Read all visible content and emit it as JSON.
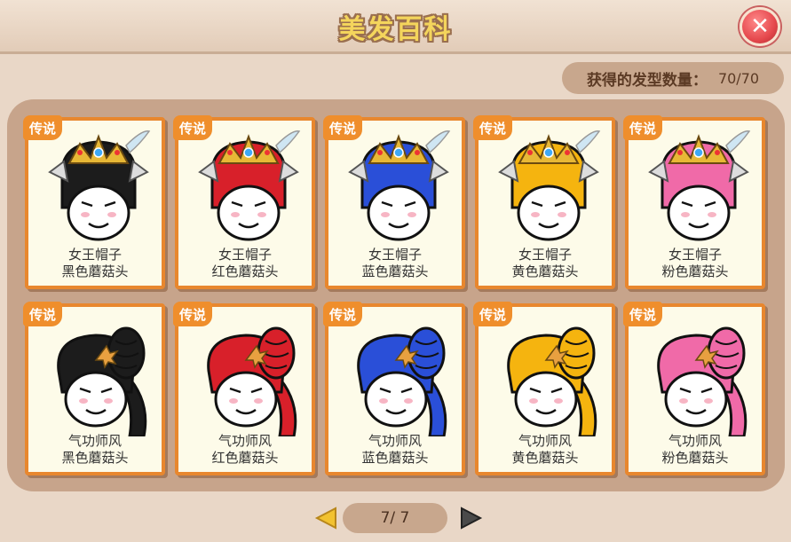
{
  "header": {
    "title": "美发百科",
    "close_icon": "close-x-icon"
  },
  "collection": {
    "label": "获得的发型数量：",
    "value": "70/70"
  },
  "cards": [
    {
      "badge": "传说",
      "line1": "女王帽子",
      "line2": "黑色蘑菇头",
      "style": "crown",
      "color": "#1c1c1c"
    },
    {
      "badge": "传说",
      "line1": "女王帽子",
      "line2": "红色蘑菇头",
      "style": "crown",
      "color": "#d8202a"
    },
    {
      "badge": "传说",
      "line1": "女王帽子",
      "line2": "蓝色蘑菇头",
      "style": "crown",
      "color": "#2a4fd8"
    },
    {
      "badge": "传说",
      "line1": "女王帽子",
      "line2": "黄色蘑菇头",
      "style": "crown",
      "color": "#f5b40f"
    },
    {
      "badge": "传说",
      "line1": "女王帽子",
      "line2": "粉色蘑菇头",
      "style": "crown",
      "color": "#f06aa8"
    },
    {
      "badge": "传说",
      "line1": "气功师风",
      "line2": "黑色蘑菇头",
      "style": "braid",
      "color": "#1c1c1c"
    },
    {
      "badge": "传说",
      "line1": "气功师风",
      "line2": "红色蘑菇头",
      "style": "braid",
      "color": "#d8202a"
    },
    {
      "badge": "传说",
      "line1": "气功师风",
      "line2": "蓝色蘑菇头",
      "style": "braid",
      "color": "#2a4fd8"
    },
    {
      "badge": "传说",
      "line1": "气功师风",
      "line2": "黄色蘑菇头",
      "style": "braid",
      "color": "#f5b40f"
    },
    {
      "badge": "传说",
      "line1": "气功师风",
      "line2": "粉色蘑菇头",
      "style": "braid",
      "color": "#f06aa8"
    }
  ],
  "pager": {
    "text": "7/ 7",
    "prev_icon": "triangle-left-icon",
    "next_icon": "triangle-right-icon"
  }
}
